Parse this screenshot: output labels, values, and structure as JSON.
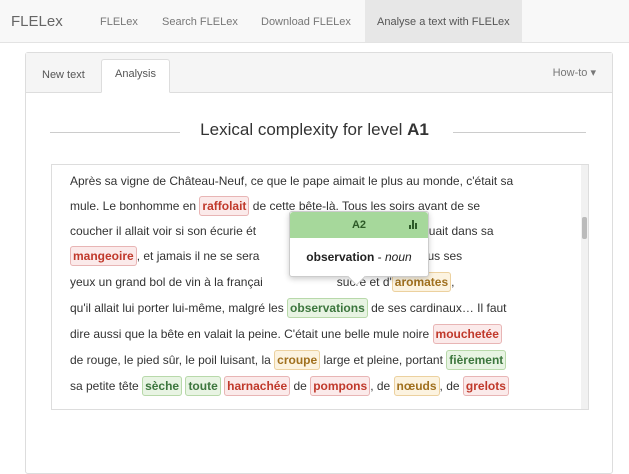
{
  "navbar": {
    "brand": "FLELex",
    "items": [
      "FLELex",
      "Search FLELex",
      "Download FLELex",
      "Analyse a text with FLELex"
    ]
  },
  "tabs": {
    "new_text": "New text",
    "analysis": "Analysis",
    "howto": "How-to ▾"
  },
  "title": {
    "prefix": "Lexical complexity for level ",
    "level": "A1"
  },
  "text": {
    "l1": "Après sa vigne de Château-Neuf, ce que le pape aimait le plus au monde, c'était sa",
    "l2a": "mule. Le bonhomme en",
    "l2w": "raffolait",
    "l2b": "de cette bête-là. Tous les soirs avant de se",
    "l3a": "coucher il allait voir si son écurie ét",
    "l3b": "ne manquait dans sa",
    "l4w": "mangeoire",
    "l4a": ", et jamais il ne se sera",
    "l4b": "ire préparer sous ses",
    "l5a": "yeux un grand bol de vin à la françai",
    "l5b": "sucre et d'",
    "l5w": "aromates",
    "l5c": ",",
    "l6a": "qu'il allait lui porter lui-même, malgré les",
    "l6w": "observations",
    "l6b": "de ses cardinaux… Il faut",
    "l7a": "dire aussi que la bête en valait la peine. C'était une belle mule noire",
    "l7w": "mouchetée",
    "l8a": "de rouge, le pied sûr, le poil luisant, la",
    "l8w": "croupe",
    "l8b": "large et pleine, portant",
    "l8w2": "fièrement",
    "l9a": "sa petite tête",
    "l9w1": "sèche",
    "l9w2": "toute",
    "l9w3": "harnachée",
    "l9b": "de",
    "l9w4": "pompons",
    "l9c": ", de",
    "l9w5": "nœuds",
    "l9d": ", de",
    "l9w6": "grelots"
  },
  "popover": {
    "level": "A2",
    "word": "observation",
    "sep": " - ",
    "pos": "noun"
  },
  "colors": {
    "red": "#c0392b",
    "green": "#3c763d",
    "gold": "#a0701e",
    "popover_header": "#a6d89b"
  }
}
